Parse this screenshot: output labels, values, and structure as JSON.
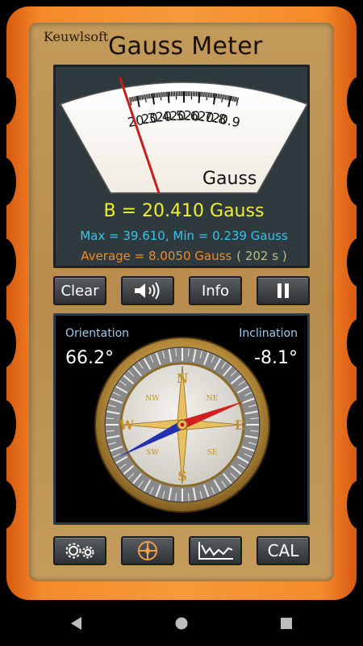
{
  "app": {
    "brand": "Keuwlsoft",
    "title": "Gauss Meter"
  },
  "meter": {
    "dial_labels": [
      "20.3",
      "20.4",
      "20.5",
      "20.6",
      "20.7",
      "20.8",
      "20.9"
    ],
    "unit_label": "Gauss",
    "needle_value": 20.41,
    "b_reading": "B = 20.410 Gauss",
    "max_min": "Max = 39.610,  Min = 0.239 Gauss",
    "average": "Average = 8.0050 Gauss",
    "elapsed": "( 202 s )"
  },
  "buttons": {
    "clear": "Clear",
    "sound_icon": "speaker-icon",
    "info": "Info",
    "pause_icon": "pause-icon"
  },
  "compass": {
    "orientation_label": "Orientation",
    "orientation_value": "66.2°",
    "inclination_label": "Inclination",
    "inclination_value": "-8.1°",
    "cardinals": [
      "N",
      "E",
      "S",
      "W"
    ],
    "intercardinals": [
      "NE",
      "SE",
      "SW",
      "NW"
    ]
  },
  "toolbar": {
    "settings_icon": "gears-icon",
    "compass_icon": "compass-icon",
    "graph_icon": "graph-icon",
    "cal": "CAL"
  },
  "colors": {
    "frame": "#f58a2a",
    "panel": "#c29a5a",
    "b_reading": "#f2f02a",
    "max_min": "#36c4f0",
    "average": "#f08a2a",
    "needle": "#c81e1e"
  },
  "navbar": {
    "back_icon": "back-triangle-icon",
    "home_icon": "home-circle-icon",
    "recents_icon": "recents-square-icon"
  }
}
